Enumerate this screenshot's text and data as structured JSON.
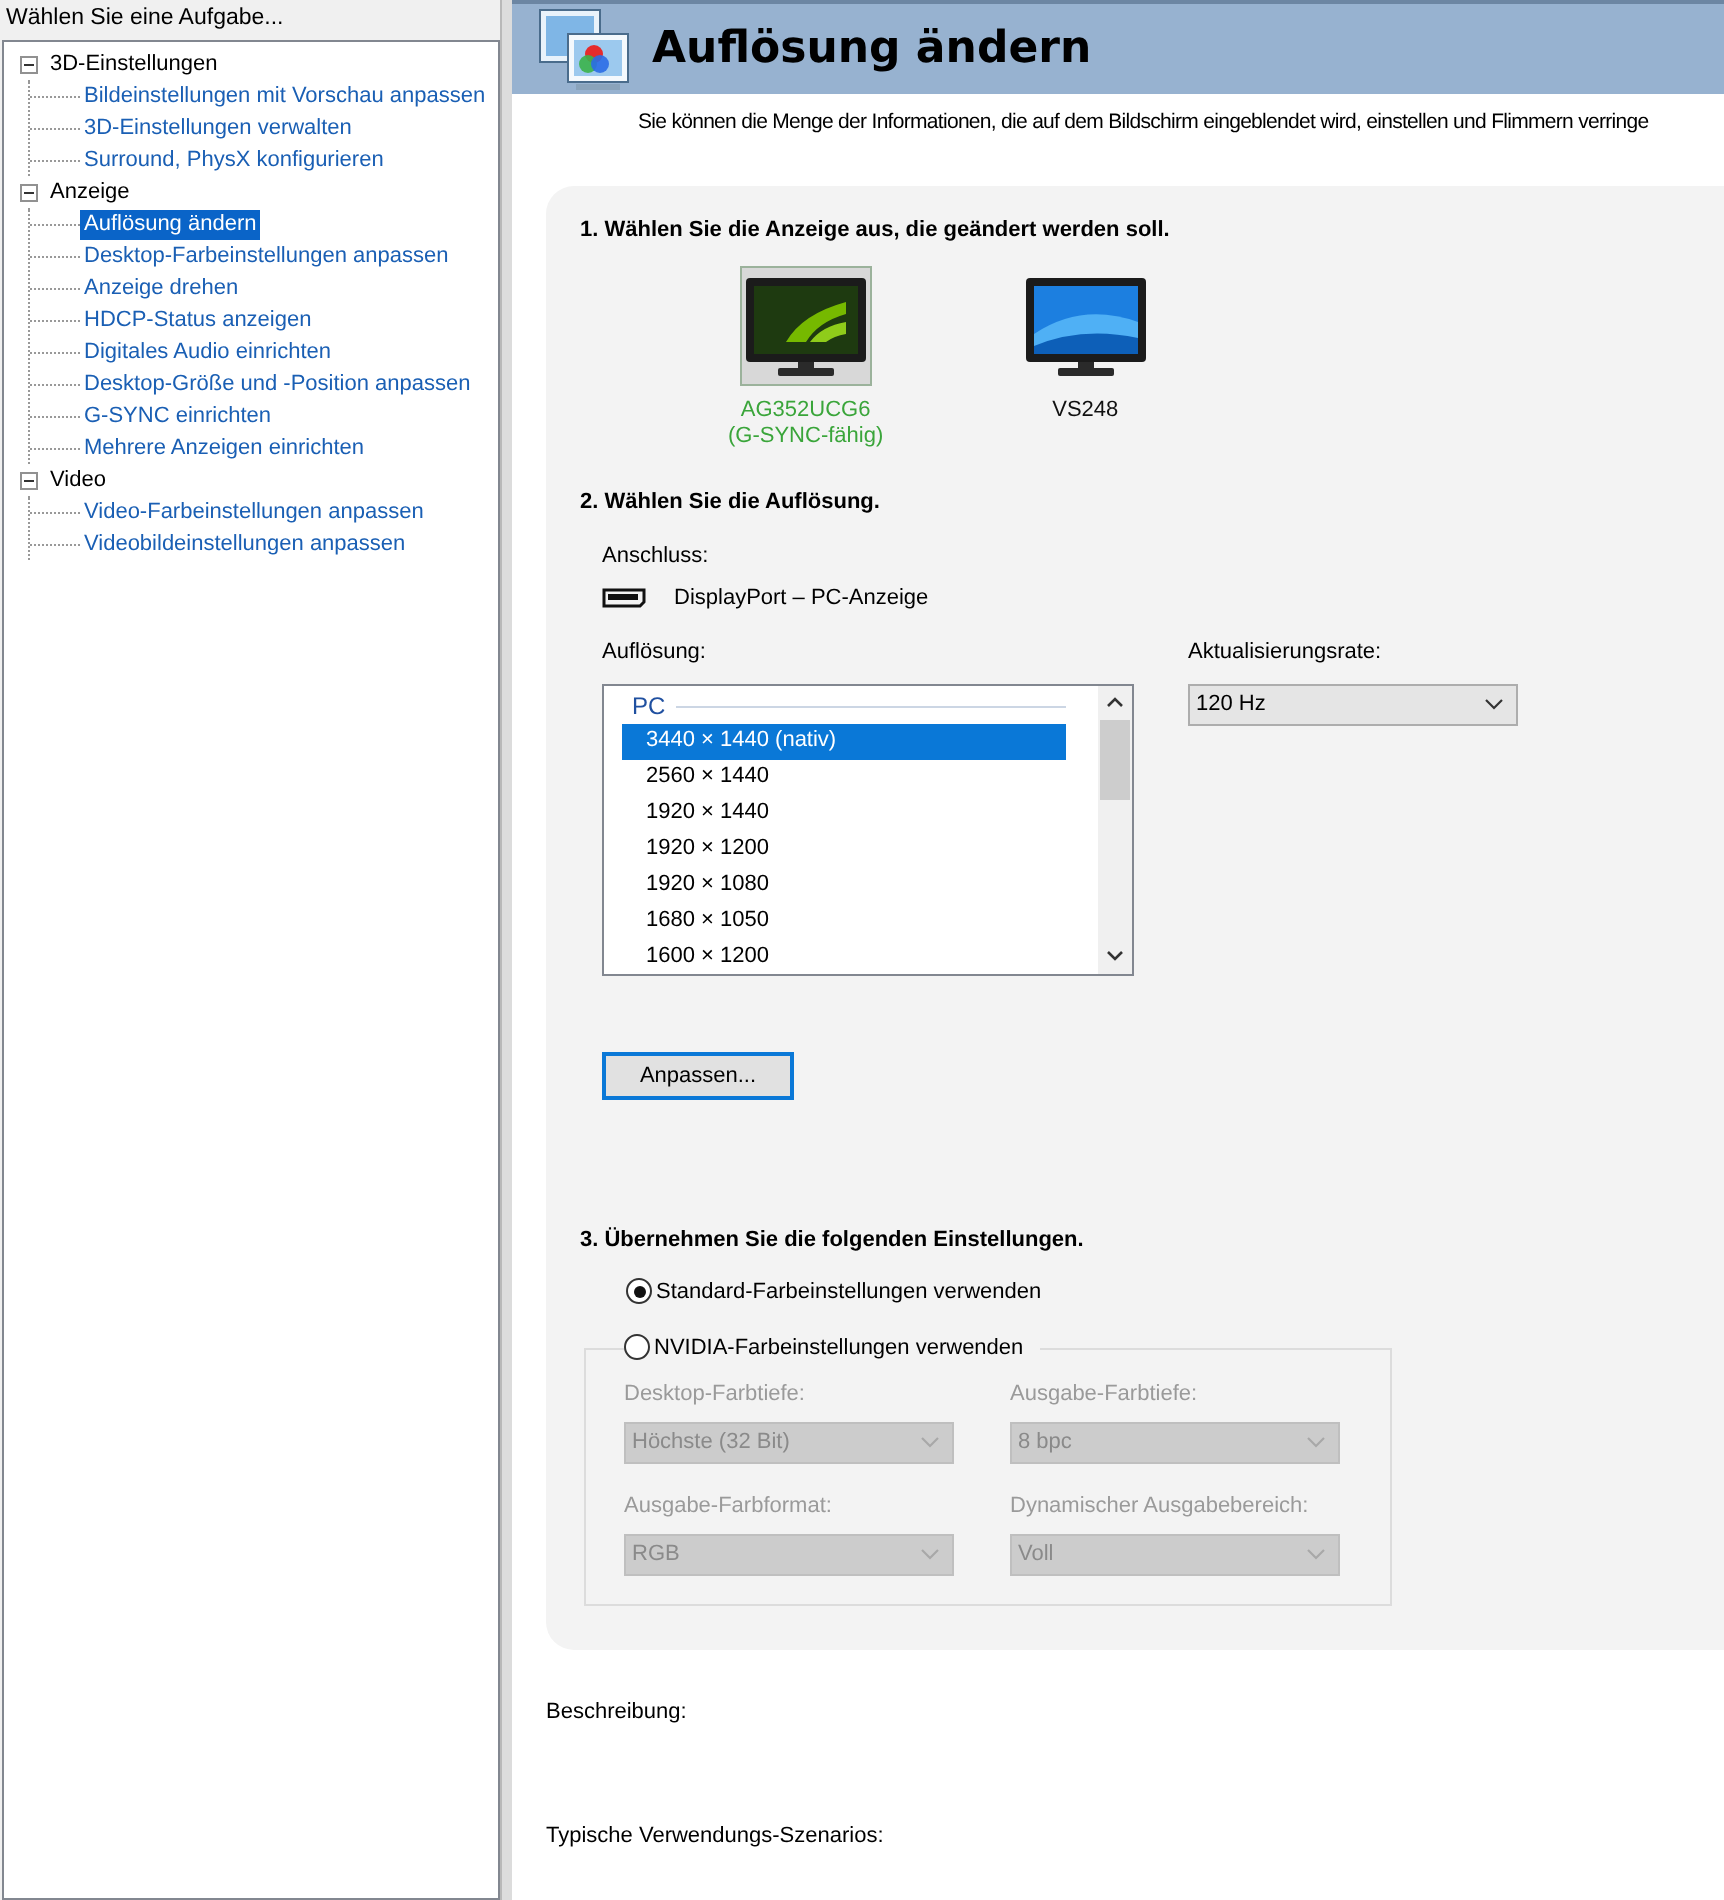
{
  "sidebar": {
    "title": "Wählen Sie eine Aufgabe...",
    "tree": [
      {
        "label": "3D-Einstellungen",
        "expanded": true,
        "children": [
          {
            "label": "Bildeinstellungen mit Vorschau anpassen",
            "selected": false
          },
          {
            "label": "3D-Einstellungen verwalten",
            "selected": false
          },
          {
            "label": "Surround, PhysX konfigurieren",
            "selected": false
          }
        ]
      },
      {
        "label": "Anzeige",
        "expanded": true,
        "children": [
          {
            "label": "Auflösung ändern",
            "selected": true
          },
          {
            "label": "Desktop-Farbeinstellungen anpassen",
            "selected": false
          },
          {
            "label": "Anzeige drehen",
            "selected": false
          },
          {
            "label": "HDCP-Status anzeigen",
            "selected": false
          },
          {
            "label": "Digitales Audio einrichten",
            "selected": false
          },
          {
            "label": "Desktop-Größe und -Position anpassen",
            "selected": false
          },
          {
            "label": "G-SYNC einrichten",
            "selected": false
          },
          {
            "label": "Mehrere Anzeigen einrichten",
            "selected": false
          }
        ]
      },
      {
        "label": "Video",
        "expanded": true,
        "children": [
          {
            "label": "Video-Farbeinstellungen anpassen",
            "selected": false
          },
          {
            "label": "Videobildeinstellungen anpassen",
            "selected": false
          }
        ]
      }
    ]
  },
  "page": {
    "title": "Auflösung ändern",
    "description": "Sie können die Menge der Informationen, die auf dem Bildschirm eingeblendet wird, einstellen und Flimmern verringe"
  },
  "step1": {
    "heading": "1. Wählen Sie die Anzeige aus, die geändert werden soll.",
    "displays": [
      {
        "name": "AG352UCG6",
        "note": "(G-SYNC-fähig)",
        "kind": "gsync",
        "selected": true
      },
      {
        "name": "VS248",
        "kind": "standard",
        "selected": false
      }
    ]
  },
  "step2": {
    "heading": "2. Wählen Sie die Auflösung.",
    "connection_label": "Anschluss:",
    "connection": "DisplayPort – PC-Anzeige",
    "resolution_label": "Auflösung:",
    "resolution_group": "PC",
    "resolutions": [
      {
        "label": "3440 × 1440 (nativ)",
        "selected": true
      },
      {
        "label": "2560 × 1440",
        "selected": false
      },
      {
        "label": "1920 × 1440",
        "selected": false
      },
      {
        "label": "1920 × 1200",
        "selected": false
      },
      {
        "label": "1920 × 1080",
        "selected": false
      },
      {
        "label": "1680 × 1050",
        "selected": false
      },
      {
        "label": "1600 × 1200",
        "selected": false
      }
    ],
    "refresh_label": "Aktualisierungsrate:",
    "refresh_value": "120 Hz",
    "customize_button": "Anpassen..."
  },
  "step3": {
    "heading": "3. Übernehmen Sie die folgenden Einstellungen.",
    "options": [
      {
        "label": "Standard-Farbeinstellungen verwenden",
        "selected": true
      },
      {
        "label": "NVIDIA-Farbeinstellungen verwenden",
        "selected": false
      }
    ],
    "color_settings": [
      {
        "label": "Desktop-Farbtiefe:",
        "value": "Höchste (32 Bit)",
        "disabled": true
      },
      {
        "label": "Ausgabe-Farbtiefe:",
        "value": "8 bpc",
        "disabled": true
      },
      {
        "label": "Ausgabe-Farbformat:",
        "value": "RGB",
        "disabled": true
      },
      {
        "label": "Dynamischer Ausgabebereich:",
        "value": "Voll",
        "disabled": true
      }
    ]
  },
  "footer": {
    "description_label": "Beschreibung:",
    "scenarios_label": "Typische Verwendungs-Szenarios:"
  }
}
